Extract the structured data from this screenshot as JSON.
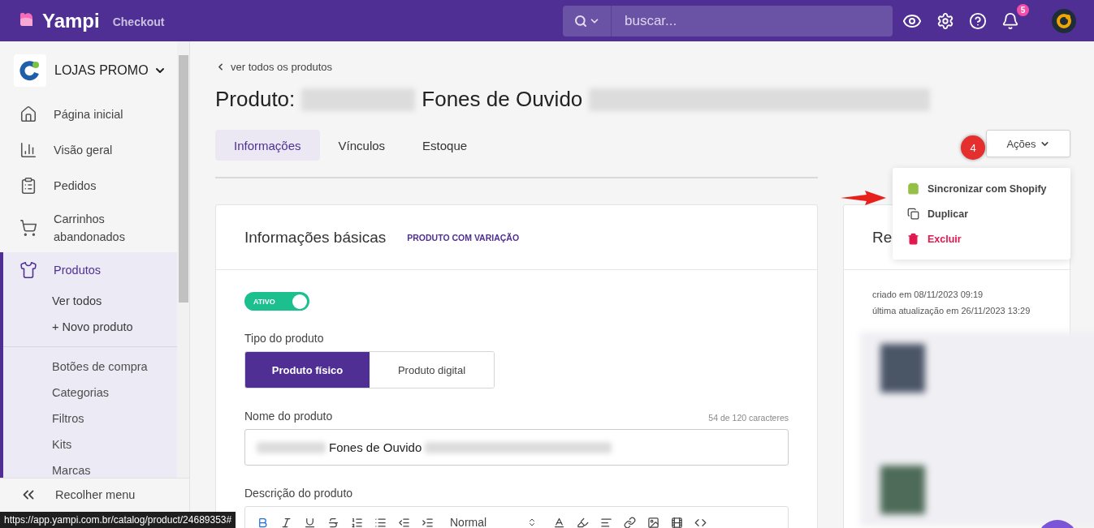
{
  "topbar": {
    "logo": "Yampi",
    "product": "Checkout",
    "search": {
      "placeholder": "buscar..."
    },
    "notifications": "5"
  },
  "sidebar": {
    "store": "LOJAS PROMO",
    "items": [
      {
        "label": "Página inicial",
        "selected": false
      },
      {
        "label": "Visão geral",
        "selected": false
      },
      {
        "label": "Pedidos",
        "selected": false
      },
      {
        "label": "Carrinhos abandonados",
        "selected": false
      },
      {
        "label": "Produtos",
        "selected": true,
        "children": [
          {
            "label": "Ver todos",
            "kind": "primary"
          },
          {
            "label": "+ Novo produto",
            "kind": "primary"
          },
          {
            "label": "Botões de compra",
            "kind": "secondary"
          },
          {
            "label": "Categorias",
            "kind": "secondary"
          },
          {
            "label": "Filtros",
            "kind": "secondary"
          },
          {
            "label": "Kits",
            "kind": "secondary"
          },
          {
            "label": "Marcas",
            "kind": "secondary"
          }
        ]
      }
    ],
    "collapse": "Recolher menu"
  },
  "back_link": "ver todos os produtos",
  "title": [
    {
      "kind": "text",
      "text": "Produto:"
    },
    {
      "kind": "redacted"
    },
    {
      "kind": "text",
      "text": "Fones de Ouvido"
    },
    {
      "kind": "redacted"
    }
  ],
  "tabs": [
    {
      "label": "Informações",
      "selected": true
    },
    {
      "label": "Vínculos",
      "selected": false
    },
    {
      "label": "Estoque",
      "selected": false
    }
  ],
  "actions": {
    "label": "Ações",
    "expanded": true,
    "step_badge": "4",
    "menu": [
      {
        "kind": "shopify",
        "label": "Sincronizar com Shopify",
        "pointed": true
      },
      {
        "kind": "duplicate",
        "label": "Duplicar",
        "pointed": false
      },
      {
        "kind": "delete",
        "label": "Excluir",
        "pointed": false
      }
    ]
  },
  "basic_info": {
    "title": "Informações básicas",
    "tag": "PRODUTO COM VARIAÇÃO",
    "status_toggle": {
      "label": "ATIVO",
      "on": true
    },
    "type": {
      "label": "Tipo do produto",
      "options": [
        {
          "label": "Produto físico",
          "selected": true
        },
        {
          "label": "Produto digital",
          "selected": false
        }
      ]
    },
    "name": {
      "label": "Nome do produto",
      "counter": "54 de 120 caracteres",
      "value": [
        {
          "kind": "redacted"
        },
        {
          "kind": "text",
          "text": "Fones de Ouvido"
        },
        {
          "kind": "redacted"
        }
      ]
    },
    "description": {
      "label": "Descrição do produto",
      "format": "Normal",
      "bold_active": true
    }
  },
  "side_card": {
    "title": "Re",
    "created": "criado em 08/11/2023 09:19",
    "updated": "última atualização em 26/11/2023 13:29"
  },
  "status_url": "https://app.yampi.com.br/catalog/product/24689353#"
}
